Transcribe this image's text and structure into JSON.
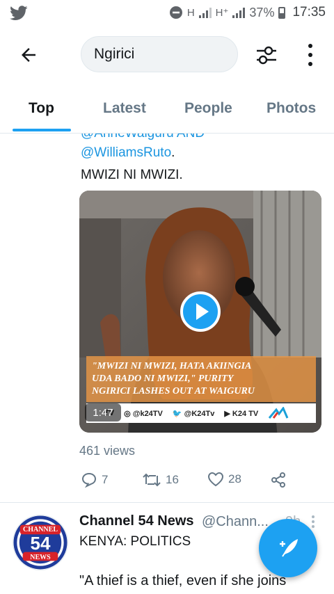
{
  "status": {
    "network_1": "H",
    "network_2": "H⁺",
    "battery": "37%",
    "time": "17:35"
  },
  "search": {
    "query": "Ngirici"
  },
  "tabs": [
    {
      "label": "Top"
    },
    {
      "label": "Latest"
    },
    {
      "label": "People"
    },
    {
      "label": "Photos"
    }
  ],
  "tweet1": {
    "line_partial": "@AnneWaiguru AND",
    "mention": "@WilliamsRuto",
    "mention_suffix": ".",
    "line3": "MWIZI NI MWIZI.",
    "video": {
      "duration": "1:47",
      "caption_line1": "\"MWIZI NI MWIZI, HATA AKIINGIA",
      "caption_line2": "UDA BADO NI MWIZI,\" PURITY",
      "caption_line3": "NGIRICI LASHES OUT AT WAIGURU",
      "social_1": "@k24TV",
      "social_2": "@K24Tv",
      "social_3": "K24 TV",
      "social_0": "TV"
    },
    "views": "461 views",
    "replies": "7",
    "retweets": "16",
    "likes": "28"
  },
  "tweet2": {
    "name": "Channel 54 News",
    "handle": "@Chann...",
    "time": "9h",
    "avatar_top": "CHANNEL",
    "avatar_num": "54",
    "avatar_bottom": "NEWS",
    "line1": "KENYA: POLITICS",
    "line2": "\"A thief is a thief, even if she joins"
  },
  "colors": {
    "accent": "#1da1f2",
    "mention": "#1b95e0",
    "muted": "#657786"
  }
}
